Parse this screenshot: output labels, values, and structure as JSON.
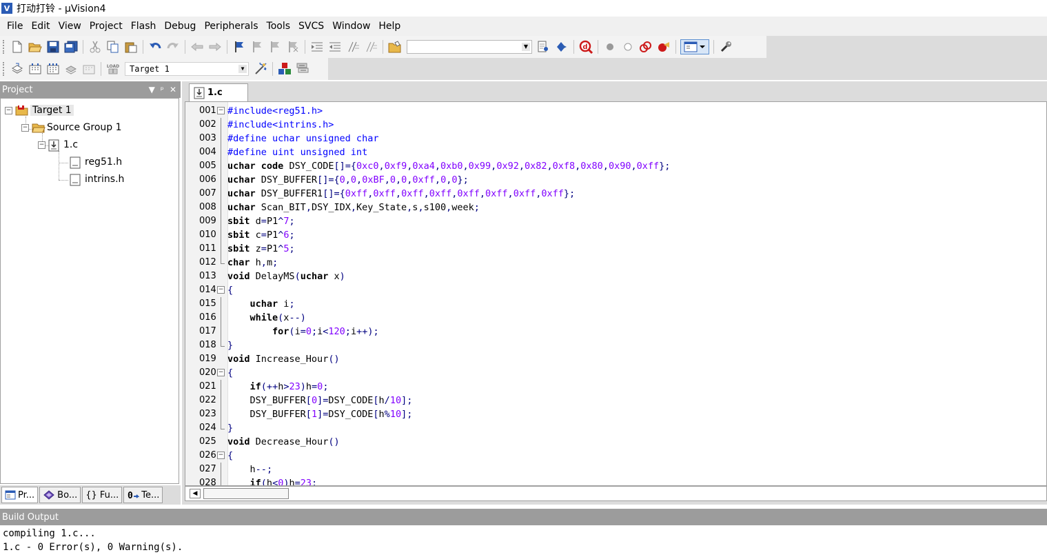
{
  "window": {
    "title": "打动打铃 - µVision4",
    "logo_text": "V"
  },
  "menu": [
    "File",
    "Edit",
    "View",
    "Project",
    "Flash",
    "Debug",
    "Peripherals",
    "Tools",
    "SVCS",
    "Window",
    "Help"
  ],
  "toolbar": {
    "find_value": "",
    "target_select": "Target 1"
  },
  "icons": {
    "new": "new-file-icon",
    "open": "open-folder-icon",
    "save": "save-icon",
    "save_all": "save-all-icon",
    "cut": "cut-icon",
    "copy": "copy-icon",
    "paste": "paste-icon",
    "undo": "undo-icon",
    "redo": "redo-icon",
    "nav_back": "nav-back-icon",
    "nav_forward": "nav-forward-icon",
    "bookmark": "bookmark-icon",
    "indent": "indent-icon",
    "unindent": "unindent-icon",
    "comment": "comment-icon",
    "uncomment": "uncomment-icon",
    "find_in_files": "find-in-files-icon",
    "debug": "debug-icon",
    "breakpoint": "breakpoint-icon",
    "settings": "wrench-icon",
    "translate": "translate-icon",
    "build": "build-icon",
    "rebuild": "rebuild-icon",
    "batch": "batch-build-icon",
    "stop": "stop-build-icon",
    "download": "download-icon",
    "target_options": "target-options-icon",
    "manage": "manage-components-icon",
    "books": "books-icon"
  },
  "project_panel": {
    "title": "Project",
    "tree": [
      {
        "label": "Target 1",
        "level": 0
      },
      {
        "label": "Source Group 1",
        "level": 1
      },
      {
        "label": "1.c",
        "level": 2
      },
      {
        "label": "reg51.h",
        "level": 3
      },
      {
        "label": "intrins.h",
        "level": 3
      }
    ],
    "tabs": [
      "Pr...",
      "Bo...",
      "{} Fu...",
      "Te..."
    ]
  },
  "editor": {
    "tab_label": "1.c",
    "lines": [
      {
        "n": "001",
        "code": "#include<reg51.h>"
      },
      {
        "n": "002",
        "code": "#include<intrins.h>"
      },
      {
        "n": "003",
        "code": "#define uchar unsigned char"
      },
      {
        "n": "004",
        "code": "#define uint unsigned int"
      },
      {
        "n": "005",
        "code": "uchar code DSY_CODE[]={0xc0,0xf9,0xa4,0xb0,0x99,0x92,0x82,0xf8,0x80,0x90,0xff};"
      },
      {
        "n": "006",
        "code": "uchar DSY_BUFFER[]={0,0,0xBF,0,0,0xff,0,0};"
      },
      {
        "n": "007",
        "code": "uchar DSY_BUFFER1[]={0xff,0xff,0xff,0xff,0xff,0xff,0xff,0xff};"
      },
      {
        "n": "008",
        "code": "uchar Scan_BIT,DSY_IDX,Key_State,s,s100,week;"
      },
      {
        "n": "009",
        "code": "sbit d=P1^7;"
      },
      {
        "n": "010",
        "code": "sbit c=P1^6;"
      },
      {
        "n": "011",
        "code": "sbit z=P1^5;"
      },
      {
        "n": "012",
        "code": "char h,m;"
      },
      {
        "n": "013",
        "code": "void DelayMS(uchar x)"
      },
      {
        "n": "014",
        "code": "{"
      },
      {
        "n": "015",
        "code": "    uchar i;"
      },
      {
        "n": "016",
        "code": "    while(x--)"
      },
      {
        "n": "017",
        "code": "        for(i=0;i<120;i++);"
      },
      {
        "n": "018",
        "code": "}"
      },
      {
        "n": "019",
        "code": "void Increase_Hour()"
      },
      {
        "n": "020",
        "code": "{"
      },
      {
        "n": "021",
        "code": "    if(++h>23)h=0;"
      },
      {
        "n": "022",
        "code": "    DSY_BUFFER[0]=DSY_CODE[h/10];"
      },
      {
        "n": "023",
        "code": "    DSY_BUFFER[1]=DSY_CODE[h%10];"
      },
      {
        "n": "024",
        "code": "}"
      },
      {
        "n": "025",
        "code": "void Decrease_Hour()"
      },
      {
        "n": "026",
        "code": "{"
      },
      {
        "n": "027",
        "code": "    h--;"
      },
      {
        "n": "028",
        "code": "    if(h<0)h=23;"
      }
    ],
    "fold_markers": {
      "001": "open",
      "012": "end",
      "014": "open",
      "018": "end",
      "020": "open",
      "024": "end",
      "026": "open"
    }
  },
  "build_output": {
    "title": "Build Output",
    "lines": [
      "compiling 1.c...",
      "1.c - 0 Error(s), 0 Warning(s)."
    ]
  },
  "colors": {
    "keyword": "#000000",
    "preprocessor": "#0000ff",
    "number": "#8000ff",
    "operator": "#000080",
    "panel_header": "#9c9c9c"
  }
}
